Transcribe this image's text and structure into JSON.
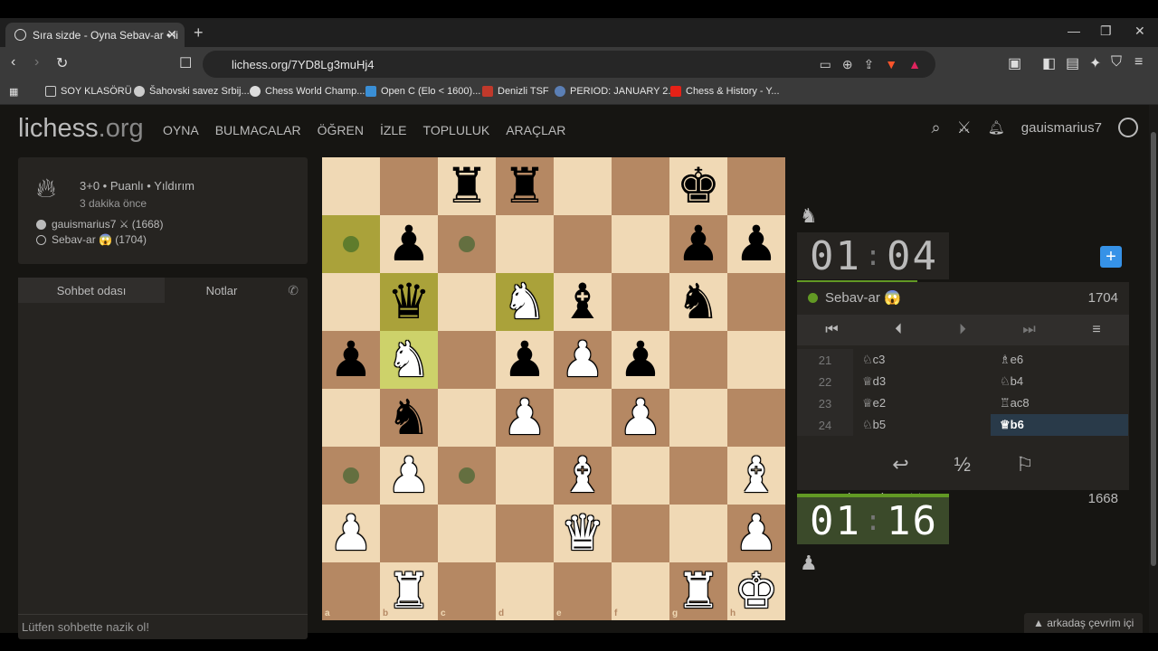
{
  "browser": {
    "tab_title": "Sıra sizde - Oyna Sebav-ar • li",
    "url": "lichess.org/7YD8Lg3muHj4",
    "bookmarks": [
      {
        "label": "SOY KLASÖRÜ",
        "color": "#e8c46a"
      },
      {
        "label": "Šahovski savez Srbij...",
        "color": "#cccccc"
      },
      {
        "label": "Chess World Champ...",
        "color": "#dddddd"
      },
      {
        "label": "Open C (Elo < 1600)...",
        "color": "#3a8fd6"
      },
      {
        "label": "Denizli TSF",
        "color": "#c0392b"
      },
      {
        "label": "PERIOD: JANUARY 2...",
        "color": "#5b7fb5"
      },
      {
        "label": "Chess & History - Y...",
        "color": "#e62117"
      }
    ]
  },
  "header": {
    "logo_main": "lichess",
    "logo_suffix": ".org",
    "nav": [
      "OYNA",
      "BULMACALAR",
      "ÖĞREN",
      "İZLE",
      "TOPLULUK",
      "ARAÇLAR"
    ],
    "username": "gauismarius7"
  },
  "game_info": {
    "title": "3+0 • Puanlı • Yıldırım",
    "time_ago": "3 dakika önce",
    "white_player": "gauismarius7 ⚔ (1668)",
    "black_player": "Sebav-ar 😱 (1704)"
  },
  "chat": {
    "tab_chat": "Sohbet odası",
    "tab_notes": "Notlar",
    "placeholder": "Lütfen sohbette nazik ol!"
  },
  "board": {
    "files": [
      "a",
      "b",
      "c",
      "d",
      "e",
      "f",
      "g",
      "h"
    ],
    "ranks": [
      "8",
      "7",
      "6",
      "5",
      "4",
      "3",
      "2",
      "1"
    ],
    "pieces": [
      {
        "sq": "c8",
        "glyph": "♜",
        "color": "black"
      },
      {
        "sq": "d8",
        "glyph": "♜",
        "color": "black"
      },
      {
        "sq": "g8",
        "glyph": "♚",
        "color": "black"
      },
      {
        "sq": "b7",
        "glyph": "♟",
        "color": "black"
      },
      {
        "sq": "g7",
        "glyph": "♟",
        "color": "black"
      },
      {
        "sq": "h7",
        "glyph": "♟",
        "color": "black"
      },
      {
        "sq": "b6",
        "glyph": "♛",
        "color": "black"
      },
      {
        "sq": "d6",
        "glyph": "♞",
        "color": "white"
      },
      {
        "sq": "e6",
        "glyph": "♝",
        "color": "black"
      },
      {
        "sq": "g6",
        "glyph": "♞",
        "color": "black"
      },
      {
        "sq": "a5",
        "glyph": "♟",
        "color": "black"
      },
      {
        "sq": "b5",
        "glyph": "♞",
        "color": "white"
      },
      {
        "sq": "d5",
        "glyph": "♟",
        "color": "black"
      },
      {
        "sq": "e5",
        "glyph": "♟",
        "color": "white"
      },
      {
        "sq": "f5",
        "glyph": "♟",
        "color": "black"
      },
      {
        "sq": "b4",
        "glyph": "♞",
        "color": "black"
      },
      {
        "sq": "d4",
        "glyph": "♟",
        "color": "white"
      },
      {
        "sq": "f4",
        "glyph": "♟",
        "color": "white"
      },
      {
        "sq": "b3",
        "glyph": "♟",
        "color": "white"
      },
      {
        "sq": "e3",
        "glyph": "♝",
        "color": "white"
      },
      {
        "sq": "h3",
        "glyph": "♝",
        "color": "white"
      },
      {
        "sq": "a2",
        "glyph": "♟",
        "color": "white"
      },
      {
        "sq": "e2",
        "glyph": "♛",
        "color": "white"
      },
      {
        "sq": "h2",
        "glyph": "♟",
        "color": "white"
      },
      {
        "sq": "b1",
        "glyph": "♜",
        "color": "white"
      },
      {
        "sq": "g1",
        "glyph": "♜",
        "color": "white"
      },
      {
        "sq": "h1",
        "glyph": "♚",
        "color": "white"
      }
    ],
    "highlights": [
      "a7",
      "b6",
      "b5",
      "d6"
    ],
    "move_dots": [
      "a7",
      "c7",
      "a3",
      "c3"
    ]
  },
  "right_panel": {
    "opponent_clock_min": "01",
    "opponent_clock_sec": "04",
    "opponent_name": "Sebav-ar 😱",
    "opponent_rating": "1704",
    "player_clock_min": "01",
    "player_clock_sec": "16",
    "player_name": "gauismarius7 ⚔",
    "player_rating": "1668",
    "moves": [
      {
        "num": "21",
        "white": "♘c3",
        "black": "♗e6"
      },
      {
        "num": "22",
        "white": "♕d3",
        "black": "♘b4"
      },
      {
        "num": "23",
        "white": "♕e2",
        "black": "♖ac8"
      },
      {
        "num": "24",
        "white": "♘b5",
        "black": "♕b6"
      }
    ],
    "draw_label": "½"
  },
  "footer": {
    "friends": "arkadaş çevrim içi"
  }
}
